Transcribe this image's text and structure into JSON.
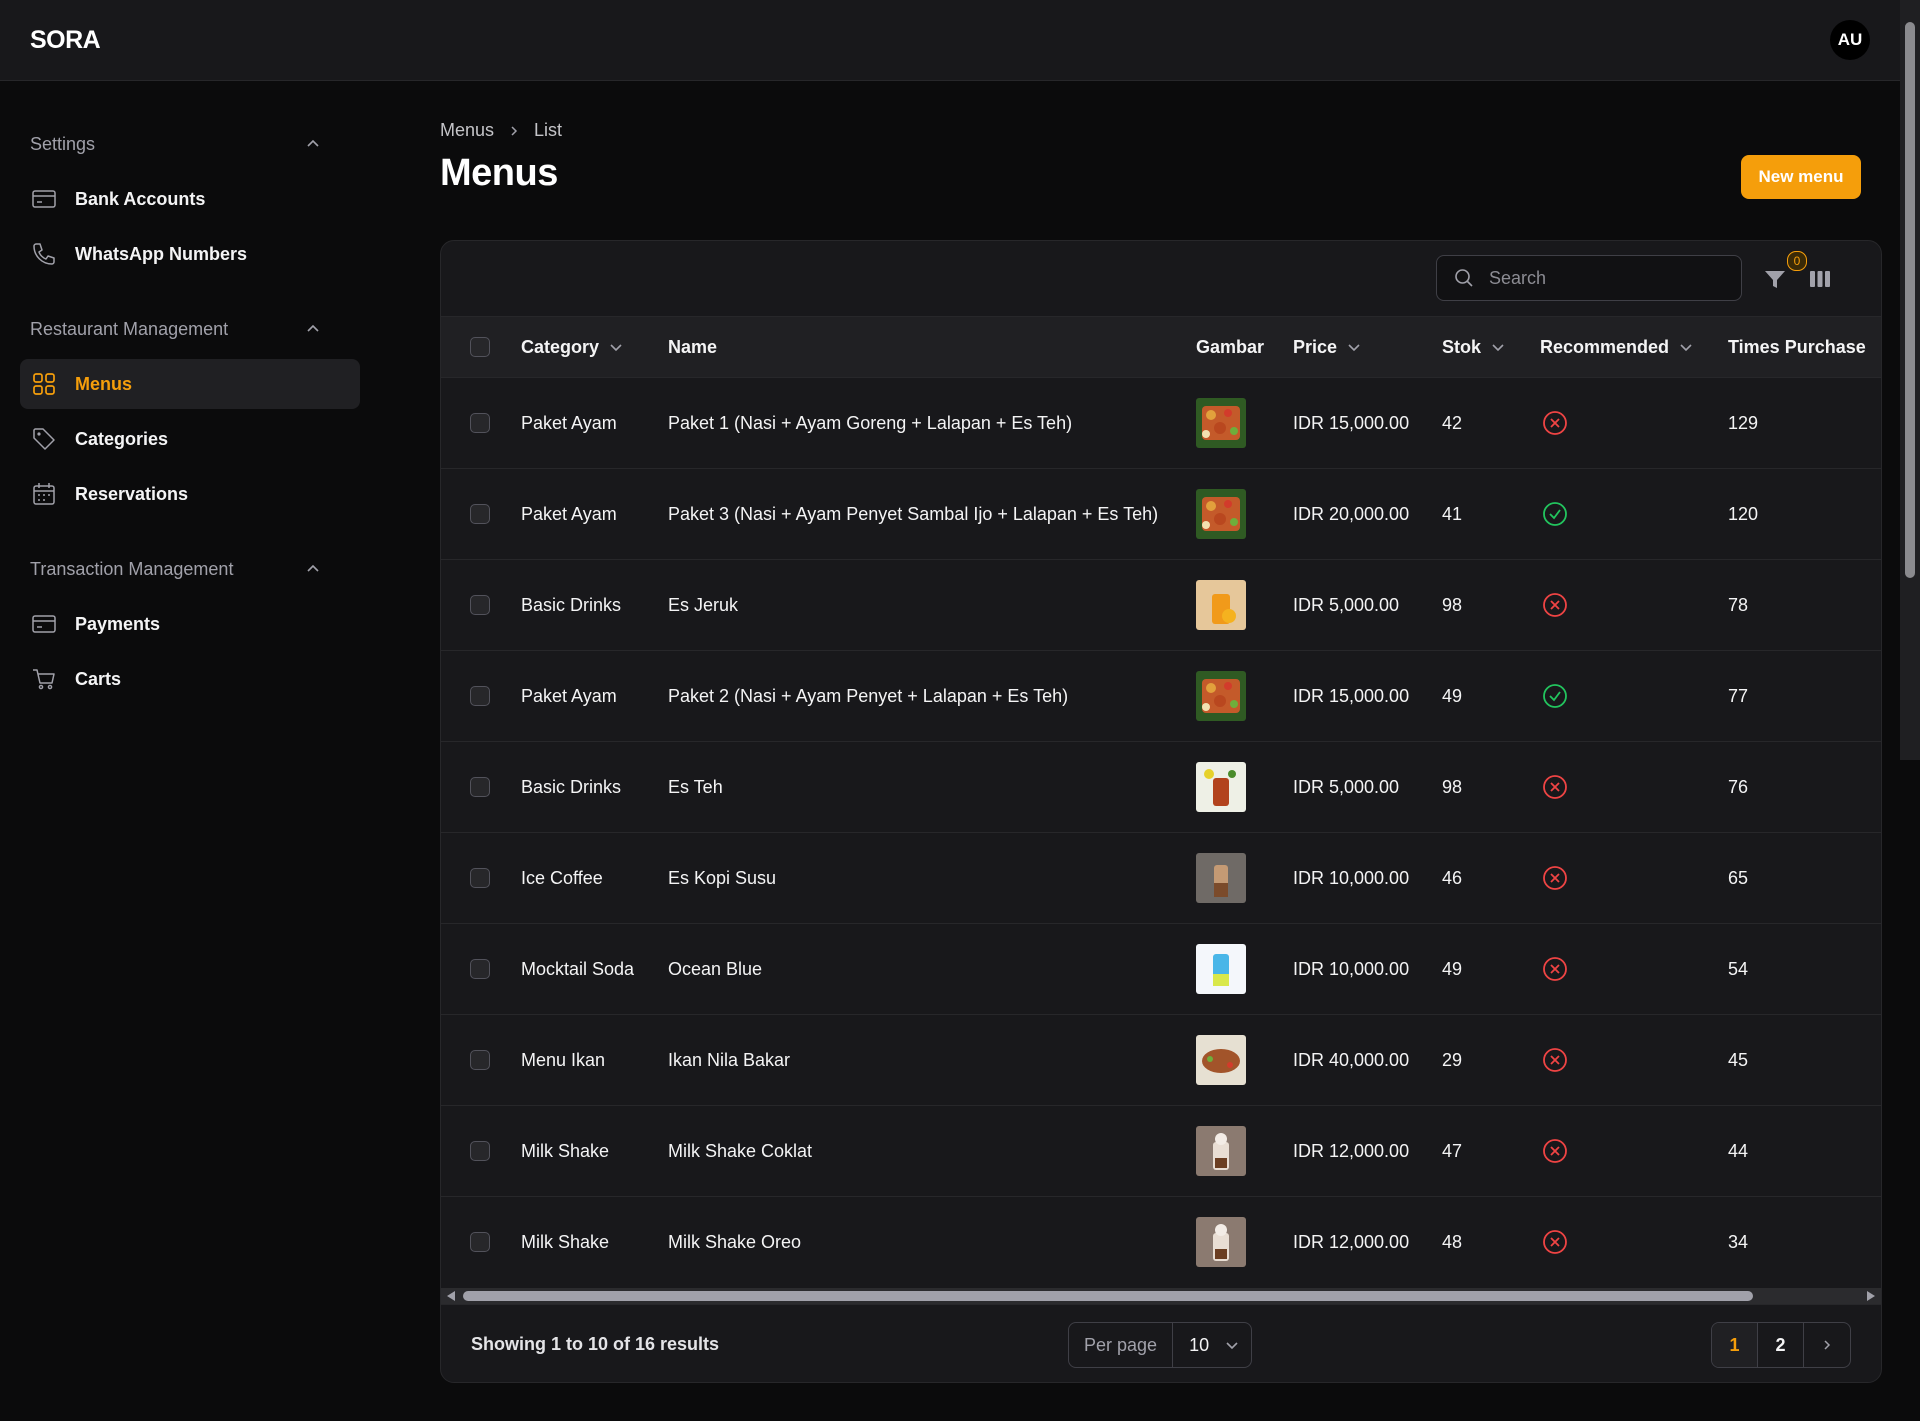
{
  "app": {
    "brand": "SORA",
    "user_initials": "AU"
  },
  "sidebar": {
    "groups": [
      {
        "label": "Settings",
        "items": [
          {
            "label": "Bank Accounts",
            "icon": "credit-card-icon"
          },
          {
            "label": "WhatsApp Numbers",
            "icon": "phone-icon"
          }
        ]
      },
      {
        "label": "Restaurant Management",
        "items": [
          {
            "label": "Menus",
            "icon": "grid-icon",
            "active": true
          },
          {
            "label": "Categories",
            "icon": "tag-icon"
          },
          {
            "label": "Reservations",
            "icon": "calendar-icon"
          }
        ]
      },
      {
        "label": "Transaction Management",
        "items": [
          {
            "label": "Payments",
            "icon": "credit-card-icon"
          },
          {
            "label": "Carts",
            "icon": "cart-icon"
          }
        ]
      }
    ]
  },
  "breadcrumb": {
    "parent": "Menus",
    "current": "List"
  },
  "page": {
    "title": "Menus",
    "new_button": "New menu"
  },
  "toolbar": {
    "search_placeholder": "Search",
    "filter_count": "0"
  },
  "table": {
    "columns": {
      "category": "Category",
      "name": "Name",
      "gambar": "Gambar",
      "price": "Price",
      "stok": "Stok",
      "recommended": "Recommended",
      "times_purchased": "Times Purchase"
    },
    "rows": [
      {
        "category": "Paket Ayam",
        "name": "Paket 1 (Nasi + Ayam Goreng + Lalapan + Es Teh)",
        "image": "chicken-platter",
        "price": "IDR 15,000.00",
        "stok": "42",
        "recommended": false,
        "times": "129"
      },
      {
        "category": "Paket Ayam",
        "name": "Paket 3 (Nasi + Ayam Penyet Sambal Ijo + Lalapan + Es Teh)",
        "image": "chicken-platter",
        "price": "IDR 20,000.00",
        "stok": "41",
        "recommended": true,
        "times": "120"
      },
      {
        "category": "Basic Drinks",
        "name": "Es Jeruk",
        "image": "orange-drink",
        "price": "IDR 5,000.00",
        "stok": "98",
        "recommended": false,
        "times": "78"
      },
      {
        "category": "Paket Ayam",
        "name": "Paket 2 (Nasi + Ayam Penyet + Lalapan + Es Teh)",
        "image": "chicken-platter",
        "price": "IDR 15,000.00",
        "stok": "49",
        "recommended": true,
        "times": "77"
      },
      {
        "category": "Basic Drinks",
        "name": "Es Teh",
        "image": "iced-tea",
        "price": "IDR 5,000.00",
        "stok": "98",
        "recommended": false,
        "times": "76"
      },
      {
        "category": "Ice Coffee",
        "name": "Es Kopi Susu",
        "image": "iced-coffee",
        "price": "IDR 10,000.00",
        "stok": "46",
        "recommended": false,
        "times": "65"
      },
      {
        "category": "Mocktail Soda",
        "name": "Ocean Blue",
        "image": "blue-soda",
        "price": "IDR 10,000.00",
        "stok": "49",
        "recommended": false,
        "times": "54"
      },
      {
        "category": "Menu Ikan",
        "name": "Ikan Nila Bakar",
        "image": "grilled-fish",
        "price": "IDR 40,000.00",
        "stok": "29",
        "recommended": false,
        "times": "45"
      },
      {
        "category": "Milk Shake",
        "name": "Milk Shake Coklat",
        "image": "milkshake",
        "price": "IDR 12,000.00",
        "stok": "47",
        "recommended": false,
        "times": "44"
      },
      {
        "category": "Milk Shake",
        "name": "Milk Shake Oreo",
        "image": "milkshake",
        "price": "IDR 12,000.00",
        "stok": "48",
        "recommended": false,
        "times": "34"
      }
    ]
  },
  "footer": {
    "showing": "Showing 1 to 10 of 16 results",
    "per_page_label": "Per page",
    "per_page_value": "10",
    "pages": [
      "1",
      "2"
    ],
    "current_page": "1"
  },
  "colors": {
    "accent": "#f59e0b",
    "success": "#22c55e",
    "danger": "#ef4444"
  }
}
